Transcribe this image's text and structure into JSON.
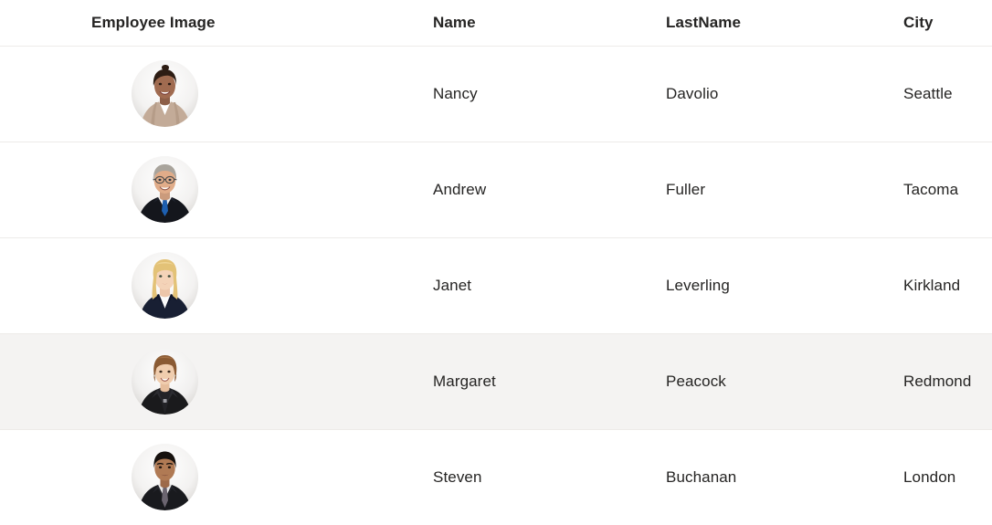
{
  "grid": {
    "columns": [
      {
        "key": "image",
        "label": "Employee Image"
      },
      {
        "key": "name",
        "label": "Name"
      },
      {
        "key": "lastname",
        "label": "LastName"
      },
      {
        "key": "city",
        "label": "City"
      }
    ],
    "rows": [
      {
        "avatar_icon": "employee-photo-nancy-davolio",
        "name": "Nancy",
        "lastname": "Davolio",
        "city": "Seattle",
        "selected": false
      },
      {
        "avatar_icon": "employee-photo-andrew-fuller",
        "name": "Andrew",
        "lastname": "Fuller",
        "city": "Tacoma",
        "selected": false
      },
      {
        "avatar_icon": "employee-photo-janet-leverling",
        "name": "Janet",
        "lastname": "Leverling",
        "city": "Kirkland",
        "selected": false
      },
      {
        "avatar_icon": "employee-photo-margaret-peacock",
        "name": "Margaret",
        "lastname": "Peacock",
        "city": "Redmond",
        "selected": true
      },
      {
        "avatar_icon": "employee-photo-steven-buchanan",
        "name": "Steven",
        "lastname": "Buchanan",
        "city": "London",
        "selected": false
      }
    ]
  },
  "colors": {
    "text": "#252423",
    "row_divider": "#edebe9",
    "selected_row_background": "#f4f3f2",
    "page_background": "#ffffff"
  }
}
